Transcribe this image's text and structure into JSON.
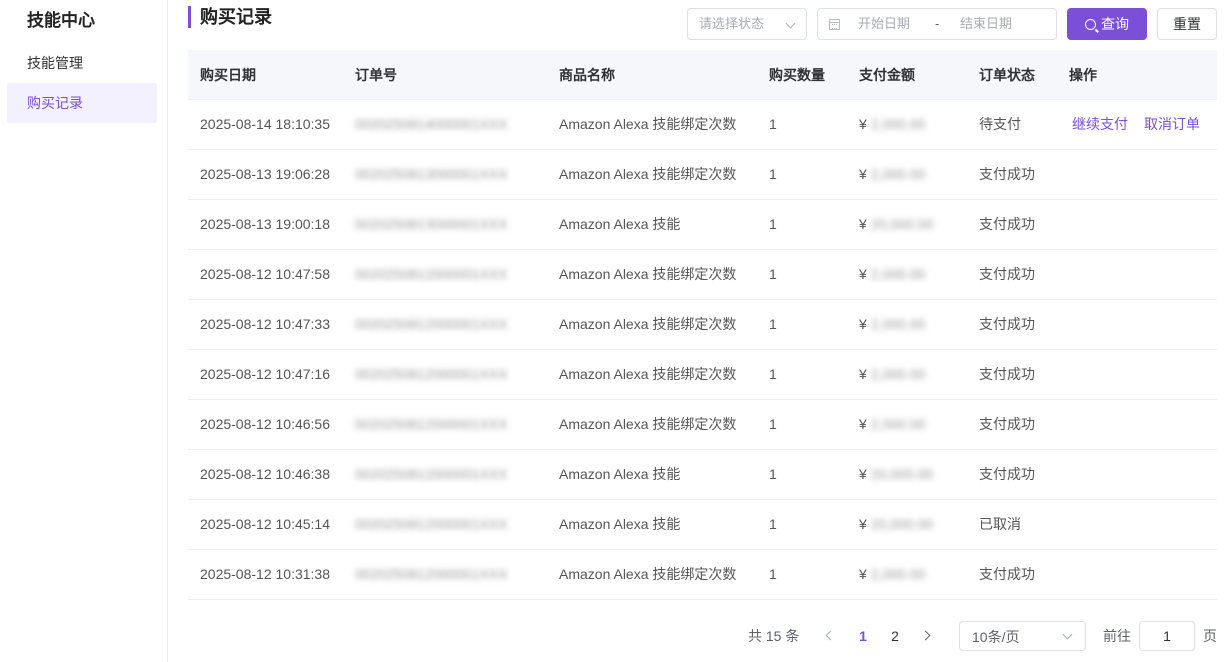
{
  "sidebar": {
    "title": "技能中心",
    "items": [
      {
        "label": "技能管理",
        "active": false
      },
      {
        "label": "购买记录",
        "active": true
      }
    ]
  },
  "header": {
    "title": "购买记录",
    "status_placeholder": "请选择状态",
    "date_start_placeholder": "开始日期",
    "date_separator": "-",
    "date_end_placeholder": "结束日期",
    "query_label": "查询",
    "reset_label": "重置"
  },
  "colors": {
    "accent": "#7b4fd6"
  },
  "table": {
    "columns": [
      "购买日期",
      "订单号",
      "商品名称",
      "购买数量",
      "支付金额",
      "订单状态",
      "操作"
    ],
    "currency": "¥",
    "rows": [
      {
        "date": "2025-08-14 18:10:35",
        "order_no": "0020250814000001XXX",
        "product": "Amazon Alexa 技能绑定次数",
        "qty": "1",
        "amount": "2,000.00",
        "status": "待支付",
        "actions": [
          "继续支付",
          "取消订单"
        ]
      },
      {
        "date": "2025-08-13 19:06:28",
        "order_no": "0020250813000001XXX",
        "product": "Amazon Alexa 技能绑定次数",
        "qty": "1",
        "amount": "2,000.00",
        "status": "支付成功",
        "actions": []
      },
      {
        "date": "2025-08-13 19:00:18",
        "order_no": "0020250813000001XXX",
        "product": "Amazon Alexa 技能",
        "qty": "1",
        "amount": "20,000.00",
        "status": "支付成功",
        "actions": []
      },
      {
        "date": "2025-08-12 10:47:58",
        "order_no": "0020250812000001XXX",
        "product": "Amazon Alexa 技能绑定次数",
        "qty": "1",
        "amount": "2,000.00",
        "status": "支付成功",
        "actions": []
      },
      {
        "date": "2025-08-12 10:47:33",
        "order_no": "0020250812000001XXX",
        "product": "Amazon Alexa 技能绑定次数",
        "qty": "1",
        "amount": "2,000.00",
        "status": "支付成功",
        "actions": []
      },
      {
        "date": "2025-08-12 10:47:16",
        "order_no": "0020250812000001XXX",
        "product": "Amazon Alexa 技能绑定次数",
        "qty": "1",
        "amount": "2,000.00",
        "status": "支付成功",
        "actions": []
      },
      {
        "date": "2025-08-12 10:46:56",
        "order_no": "0020250812000001XXX",
        "product": "Amazon Alexa 技能绑定次数",
        "qty": "1",
        "amount": "2,000.00",
        "status": "支付成功",
        "actions": []
      },
      {
        "date": "2025-08-12 10:46:38",
        "order_no": "0020250812000001XXX",
        "product": "Amazon Alexa 技能",
        "qty": "1",
        "amount": "20,000.00",
        "status": "支付成功",
        "actions": []
      },
      {
        "date": "2025-08-12 10:45:14",
        "order_no": "0020250812000001XXX",
        "product": "Amazon Alexa 技能",
        "qty": "1",
        "amount": "20,000.00",
        "status": "已取消",
        "actions": []
      },
      {
        "date": "2025-08-12 10:31:38",
        "order_no": "0020250812000001XXX",
        "product": "Amazon Alexa 技能绑定次数",
        "qty": "1",
        "amount": "2,000.00",
        "status": "支付成功",
        "actions": []
      }
    ]
  },
  "pagination": {
    "total_label": "共 15 条",
    "pages": [
      "1",
      "2"
    ],
    "current_page": "1",
    "page_size_label": "10条/页",
    "goto_label": "前往",
    "goto_value": "1",
    "page_suffix": "页"
  }
}
